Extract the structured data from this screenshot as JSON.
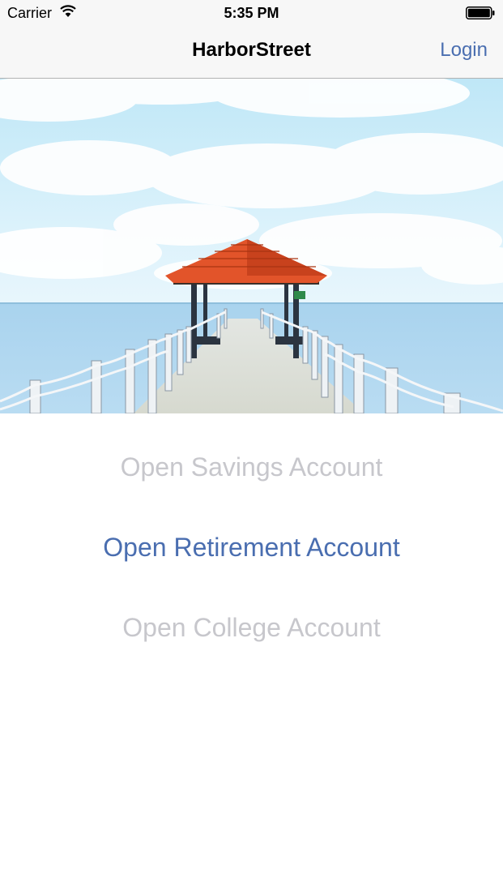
{
  "status_bar": {
    "carrier": "Carrier",
    "time": "5:35 PM"
  },
  "nav": {
    "title": "HarborStreet",
    "login_label": "Login"
  },
  "hero": {
    "image_subject": "pier-with-red-roofed-gazebo-over-sea"
  },
  "options": {
    "savings": "Open Savings Account",
    "retirement": "Open Retirement Account",
    "college": "Open College Account"
  },
  "colors": {
    "accent": "#4a6eb0",
    "disabled": "#c7c7cc",
    "bar_background": "#f7f7f7"
  }
}
